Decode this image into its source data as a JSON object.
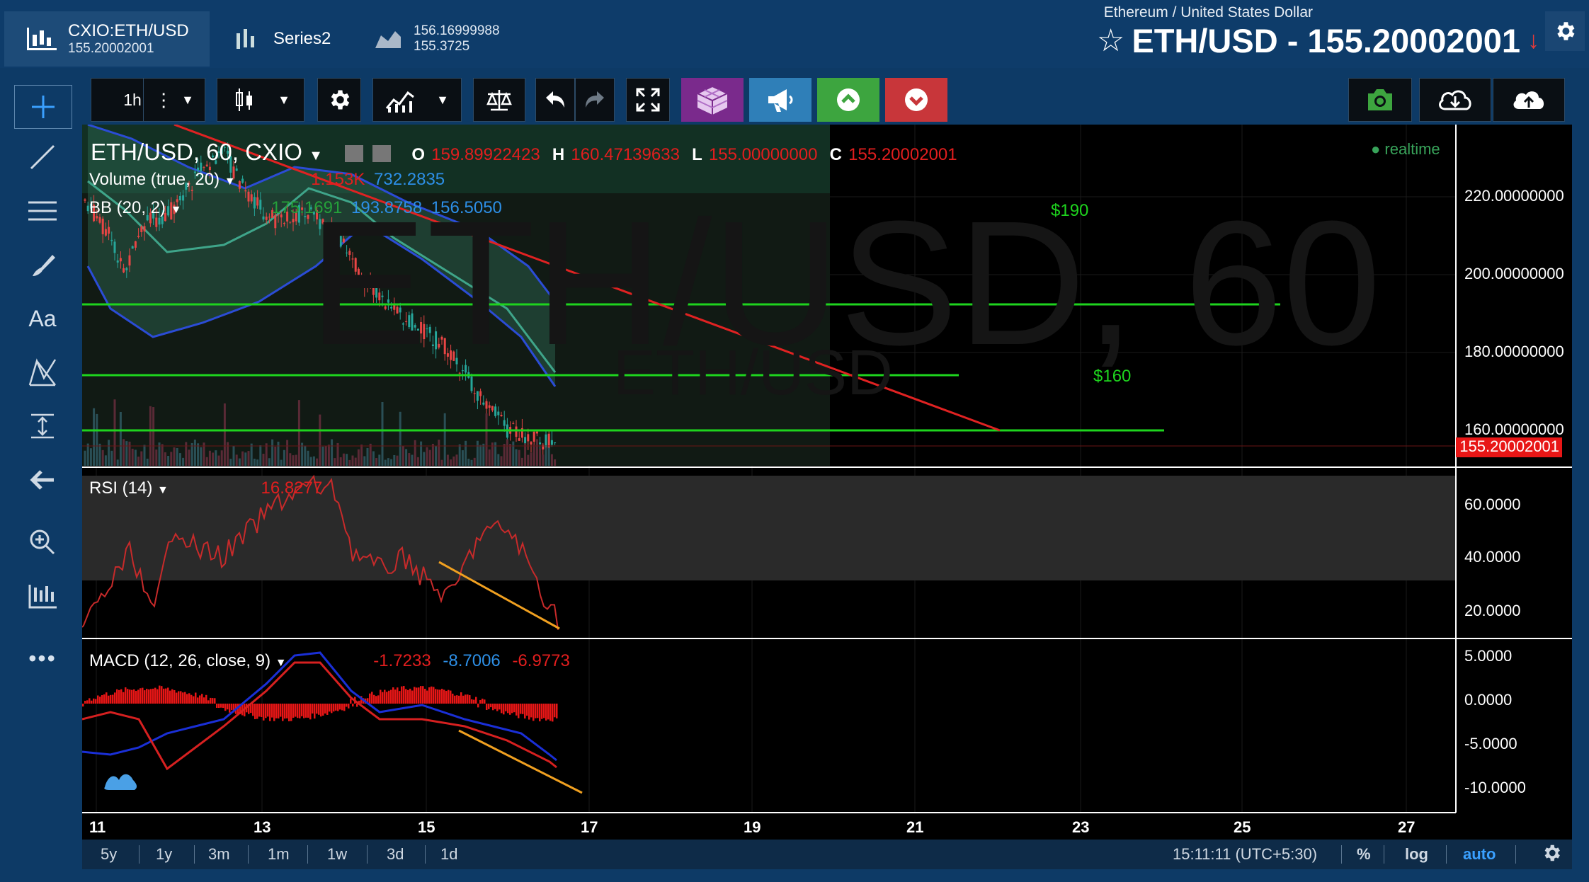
{
  "header": {
    "symbol_tab": {
      "symbol": "CXIO:ETH/USD",
      "price": "155.20002001"
    },
    "series_tab": {
      "label": "Series2"
    },
    "compare_tab": {
      "value1": "156.16999988",
      "value2": "155.3725"
    },
    "pair_description": "Ethereum / United States Dollar",
    "pair_title": "ETH/USD - 155.20002001",
    "star_glyph": "☆",
    "arrow_glyph": "↓"
  },
  "toolbar": {
    "interval": "1h",
    "colors": {
      "purple": "#7a2a8c",
      "blue": "#2f7fb8",
      "green": "#3da53f",
      "red": "#c8363a"
    }
  },
  "chart": {
    "watermark_main": "ETH/USD, 60",
    "watermark_sub": "ETH/USD",
    "legend": {
      "main_title": "ETH/USD, 60, CXIO",
      "o_label": "O",
      "o_value": "159.89922423",
      "h_label": "H",
      "h_value": "160.47139633",
      "l_label": "L",
      "l_value": "155.00000000",
      "c_label": "C",
      "c_value": "155.20002001",
      "volume_title": "Volume (true, 20)",
      "volume_value1": "1.153K",
      "volume_value2": "732.2835",
      "bb_title": "BB (20, 2)",
      "bb_value1": "175.1691",
      "bb_value2": "193.8758",
      "bb_value3": "156.5050",
      "rsi_title": "RSI (14)",
      "rsi_value": "16.8277",
      "macd_title": "MACD (12, 26, close, 9)",
      "macd_value1": "-1.7233",
      "macd_value2": "-8.7006",
      "macd_value3": "-6.9773"
    },
    "realtime": "realtime",
    "annotations": {
      "label_190": "$190",
      "label_160": "$160"
    },
    "price_axis": [
      "220.00000000",
      "200.00000000",
      "180.00000000",
      "160.00000000"
    ],
    "current_price": "155.20002001",
    "rsi_axis": [
      "60.0000",
      "40.0000",
      "20.0000"
    ],
    "macd_axis": [
      "5.0000",
      "0.0000",
      "-5.0000",
      "-10.0000"
    ],
    "time_axis": [
      "11",
      "13",
      "15",
      "17",
      "19",
      "21",
      "23",
      "25",
      "27"
    ]
  },
  "bottom": {
    "ranges": [
      "5y",
      "1y",
      "3m",
      "1m",
      "1w",
      "3d",
      "1d"
    ],
    "clock": "15:11:11 (UTC+5:30)",
    "percent": "%",
    "log": "log",
    "auto": "auto"
  }
}
